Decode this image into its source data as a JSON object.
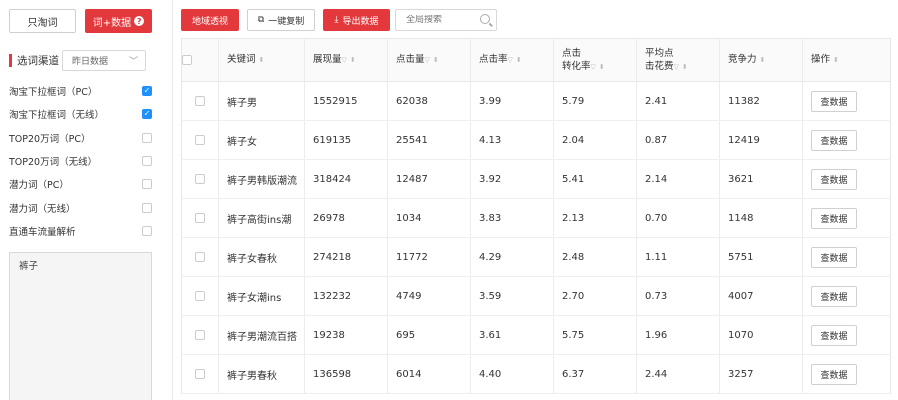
{
  "left": {
    "btn_taobao": "只淘词",
    "btn_word_data": "词+数据",
    "channel_label": "选词渠道",
    "date_select": "昨日数据",
    "options": [
      {
        "label": "淘宝下拉框词（PC）",
        "checked": true
      },
      {
        "label": "淘宝下拉框词（无线）",
        "checked": true
      },
      {
        "label": "TOP20万词（PC）",
        "checked": false
      },
      {
        "label": "TOP20万词（无线）",
        "checked": false
      },
      {
        "label": "潜力词（PC）",
        "checked": false
      },
      {
        "label": "潜力词（无线）",
        "checked": false
      },
      {
        "label": "直通车流量解析",
        "checked": false
      }
    ],
    "keyword_input": "裤子"
  },
  "toolbar": {
    "region": "地域透视",
    "copy": "一键复制",
    "export": "导出数据",
    "search_placeholder": "全局搜索"
  },
  "table": {
    "headers": {
      "keyword": "关键词",
      "impressions": "展现量",
      "clicks": "点击量",
      "ctr": "点击率",
      "cvr_line1": "点击",
      "cvr_line2": "转化率",
      "cpc_line1": "平均点",
      "cpc_line2": "击花费",
      "competition": "竞争力",
      "action": "操作"
    },
    "action_label": "查数据",
    "rows": [
      {
        "keyword": "裤子男",
        "impressions": "1552915",
        "clicks": "62038",
        "ctr": "3.99",
        "cvr": "5.79",
        "cpc": "2.41",
        "competition": "11382"
      },
      {
        "keyword": "裤子女",
        "impressions": "619135",
        "clicks": "25541",
        "ctr": "4.13",
        "cvr": "2.04",
        "cpc": "0.87",
        "competition": "12419"
      },
      {
        "keyword": "裤子男韩版潮流",
        "impressions": "318424",
        "clicks": "12487",
        "ctr": "3.92",
        "cvr": "5.41",
        "cpc": "2.14",
        "competition": "3621"
      },
      {
        "keyword": "裤子高街ins潮",
        "impressions": "26978",
        "clicks": "1034",
        "ctr": "3.83",
        "cvr": "2.13",
        "cpc": "0.70",
        "competition": "1148"
      },
      {
        "keyword": "裤子女春秋",
        "impressions": "274218",
        "clicks": "11772",
        "ctr": "4.29",
        "cvr": "2.48",
        "cpc": "1.11",
        "competition": "5751"
      },
      {
        "keyword": "裤子女潮ins",
        "impressions": "132232",
        "clicks": "4749",
        "ctr": "3.59",
        "cvr": "2.70",
        "cpc": "0.73",
        "competition": "4007"
      },
      {
        "keyword": "裤子男潮流百搭",
        "impressions": "19238",
        "clicks": "695",
        "ctr": "3.61",
        "cvr": "5.75",
        "cpc": "1.96",
        "competition": "1070"
      },
      {
        "keyword": "裤子男春秋",
        "impressions": "136598",
        "clicks": "6014",
        "ctr": "4.40",
        "cvr": "6.37",
        "cpc": "2.44",
        "competition": "3257"
      }
    ]
  },
  "colors": {
    "accent": "#e4393c",
    "check": "#1e90ff"
  }
}
